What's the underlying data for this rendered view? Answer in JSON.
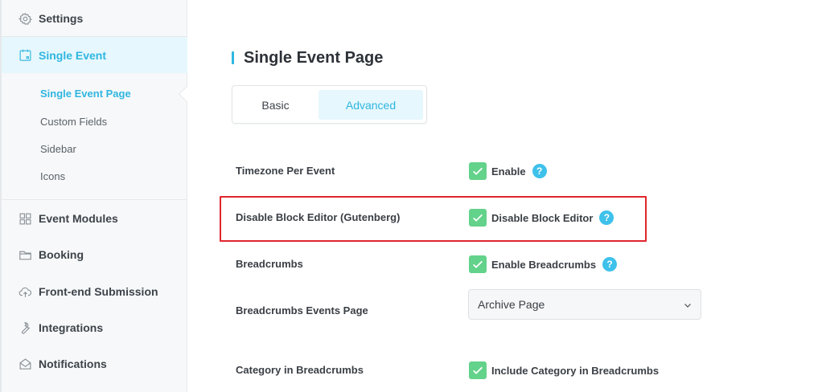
{
  "sidebar": {
    "items": [
      {
        "label": "Settings",
        "icon": "gear-icon"
      },
      {
        "label": "Single Event",
        "icon": "calendar-icon",
        "active": true
      },
      {
        "label": "Event Modules",
        "icon": "grid-icon"
      },
      {
        "label": "Booking",
        "icon": "folder-icon"
      },
      {
        "label": "Front-end Submission",
        "icon": "cloud-upload-icon"
      },
      {
        "label": "Integrations",
        "icon": "wrench-icon"
      },
      {
        "label": "Notifications",
        "icon": "envelope-icon"
      }
    ],
    "sub_items": [
      {
        "label": "Single Event Page",
        "active": true
      },
      {
        "label": "Custom Fields"
      },
      {
        "label": "Sidebar"
      },
      {
        "label": "Icons"
      }
    ]
  },
  "main": {
    "title": "Single Event Page",
    "tabs": [
      {
        "label": "Basic"
      },
      {
        "label": "Advanced",
        "active": true
      }
    ],
    "rows": [
      {
        "label": "Timezone Per Event",
        "control": "checkbox",
        "checked": true,
        "text": "Enable",
        "help": "?"
      },
      {
        "label": "Disable Block Editor (Gutenberg)",
        "control": "checkbox",
        "checked": true,
        "text": "Disable Block Editor",
        "help": "?"
      },
      {
        "label": "Breadcrumbs",
        "control": "checkbox",
        "checked": true,
        "text": "Enable Breadcrumbs",
        "help": "?"
      },
      {
        "label": "Breadcrumbs Events Page",
        "control": "select",
        "value": "Archive Page"
      },
      {
        "label": "Category in Breadcrumbs",
        "control": "checkbox",
        "checked": true,
        "text": "Include Category in Breadcrumbs"
      }
    ]
  },
  "colors": {
    "accent": "#2fb6e0",
    "checkbox": "#63d28a",
    "help": "#3ec1ea",
    "highlight": "#e0262c"
  }
}
